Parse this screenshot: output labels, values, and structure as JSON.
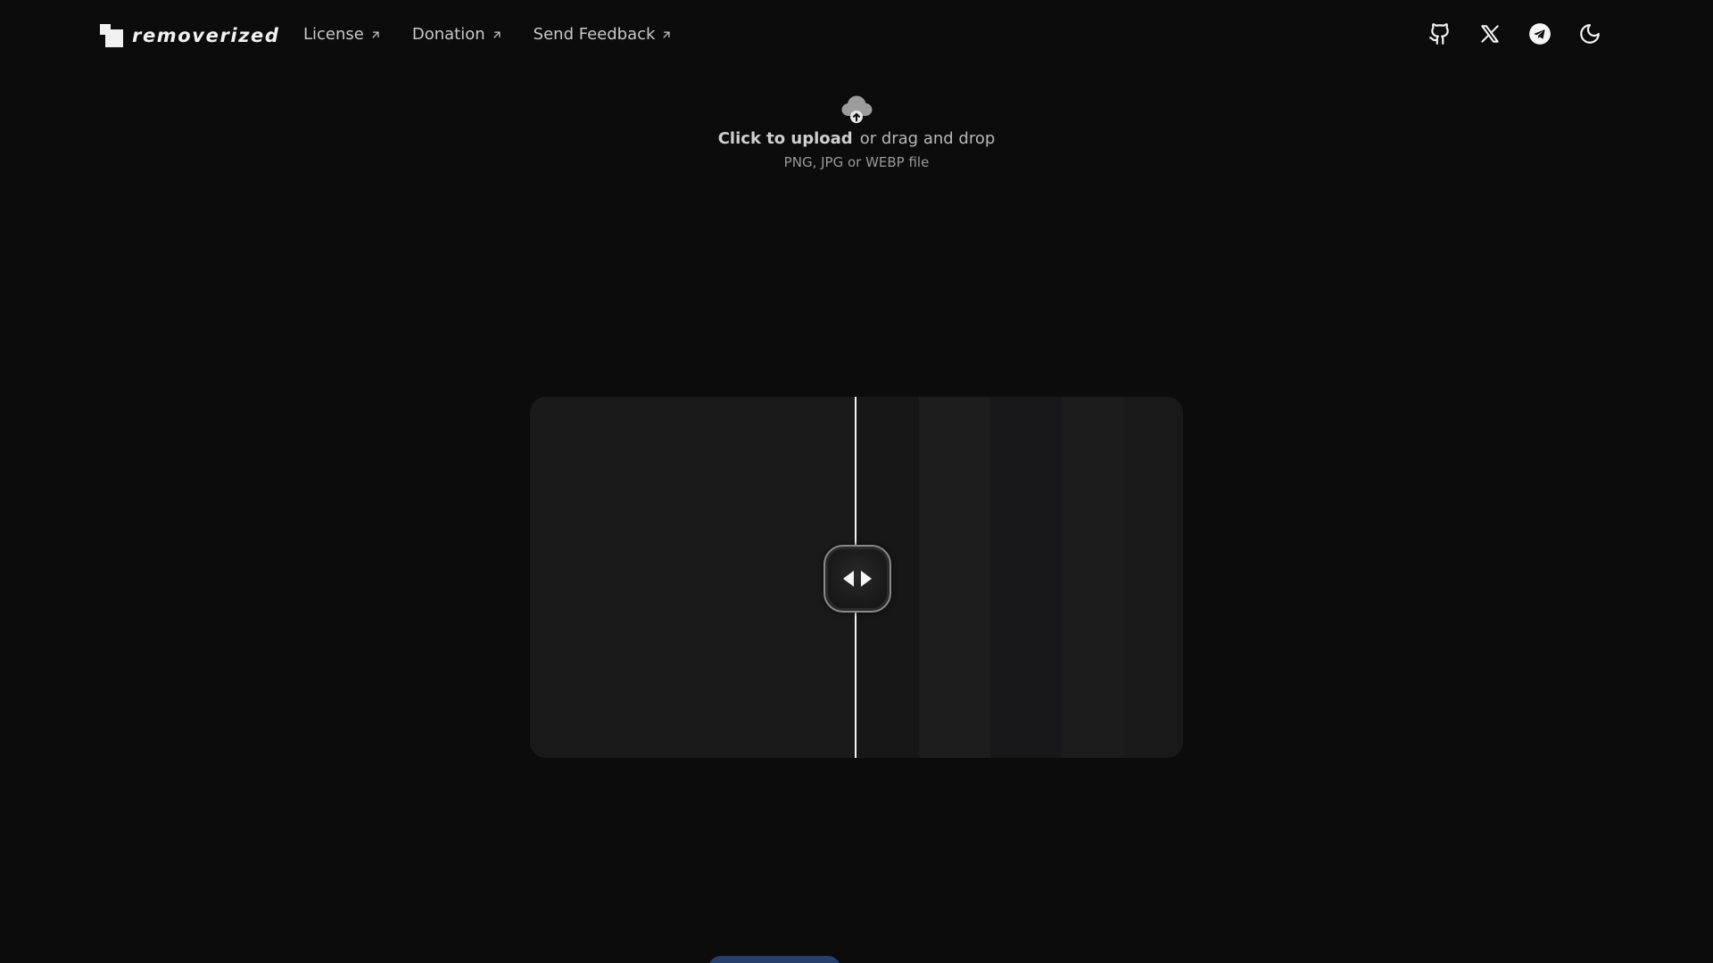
{
  "brand": {
    "name": "removerized"
  },
  "nav": {
    "items": [
      {
        "label": "License",
        "icon": "arrow-up-right-icon"
      },
      {
        "label": "Donation",
        "icon": "arrow-up-right-icon"
      },
      {
        "label": "Send Feedback",
        "icon": "arrow-up-right-icon"
      }
    ]
  },
  "header_actions": [
    {
      "icon": "github-icon"
    },
    {
      "icon": "x-icon"
    },
    {
      "icon": "telegram-icon"
    },
    {
      "icon": "moon-icon"
    }
  ],
  "upload": {
    "icon": "cloud-upload-icon",
    "cta": "Click to upload",
    "secondary": "or drag and drop",
    "formats": "PNG, JPG or WEBP file"
  },
  "compare": {
    "handle_icon": "left-right-arrows-icon",
    "split_percent": 50
  },
  "colors": {
    "background": "#0c0c0d",
    "panel": "#1a1a1b",
    "divider": "#f2f2f2",
    "button": "#27406b"
  }
}
